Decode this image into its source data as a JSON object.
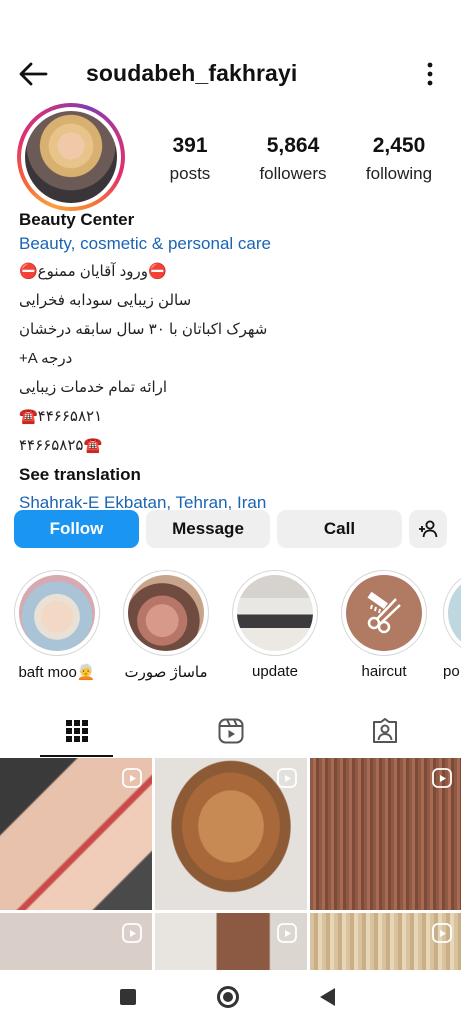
{
  "header": {
    "username": "soudabeh_fakhrayi",
    "back_icon": "arrow-left-icon",
    "more_icon": "vertical-dots-icon"
  },
  "stats": {
    "posts_count": "391",
    "posts_label": "posts",
    "followers_count": "5,864",
    "followers_label": "followers",
    "following_count": "2,450",
    "following_label": "following"
  },
  "bio": {
    "name": "Beauty Center",
    "category": "Beauty, cosmetic & personal care",
    "lines": [
      "⛔ورود آقایان ممنوع⛔",
      "سالن زیبایی سودابه فخرایی",
      "شهرک اکباتان با ۳۰ سال سابقه درخشان",
      "+A درجه",
      "ارائه تمام خدمات زیبایی",
      "☎️۴۴۶۶۵۸۲۱",
      "۴۴۶۶۵۸۲۵☎️"
    ],
    "see_translation": "See translation",
    "location": "Shahrak-E Ekbatan, Tehran, Iran"
  },
  "actions": {
    "follow": "Follow",
    "message": "Message",
    "call": "Call",
    "add_user_icon": "add-person-icon"
  },
  "highlights": [
    {
      "label": "baft moo🧑‍🦳"
    },
    {
      "label": "ماساژ صورت"
    },
    {
      "label": "update"
    },
    {
      "label": "haircut"
    },
    {
      "label": "po"
    }
  ],
  "tabs": {
    "grid_icon": "grid-icon",
    "reels_icon": "reels-icon",
    "tagged_icon": "tagged-person-icon"
  },
  "colors": {
    "accent": "#1a95f2",
    "link": "#1b64b3",
    "button_bg": "#efefef"
  }
}
